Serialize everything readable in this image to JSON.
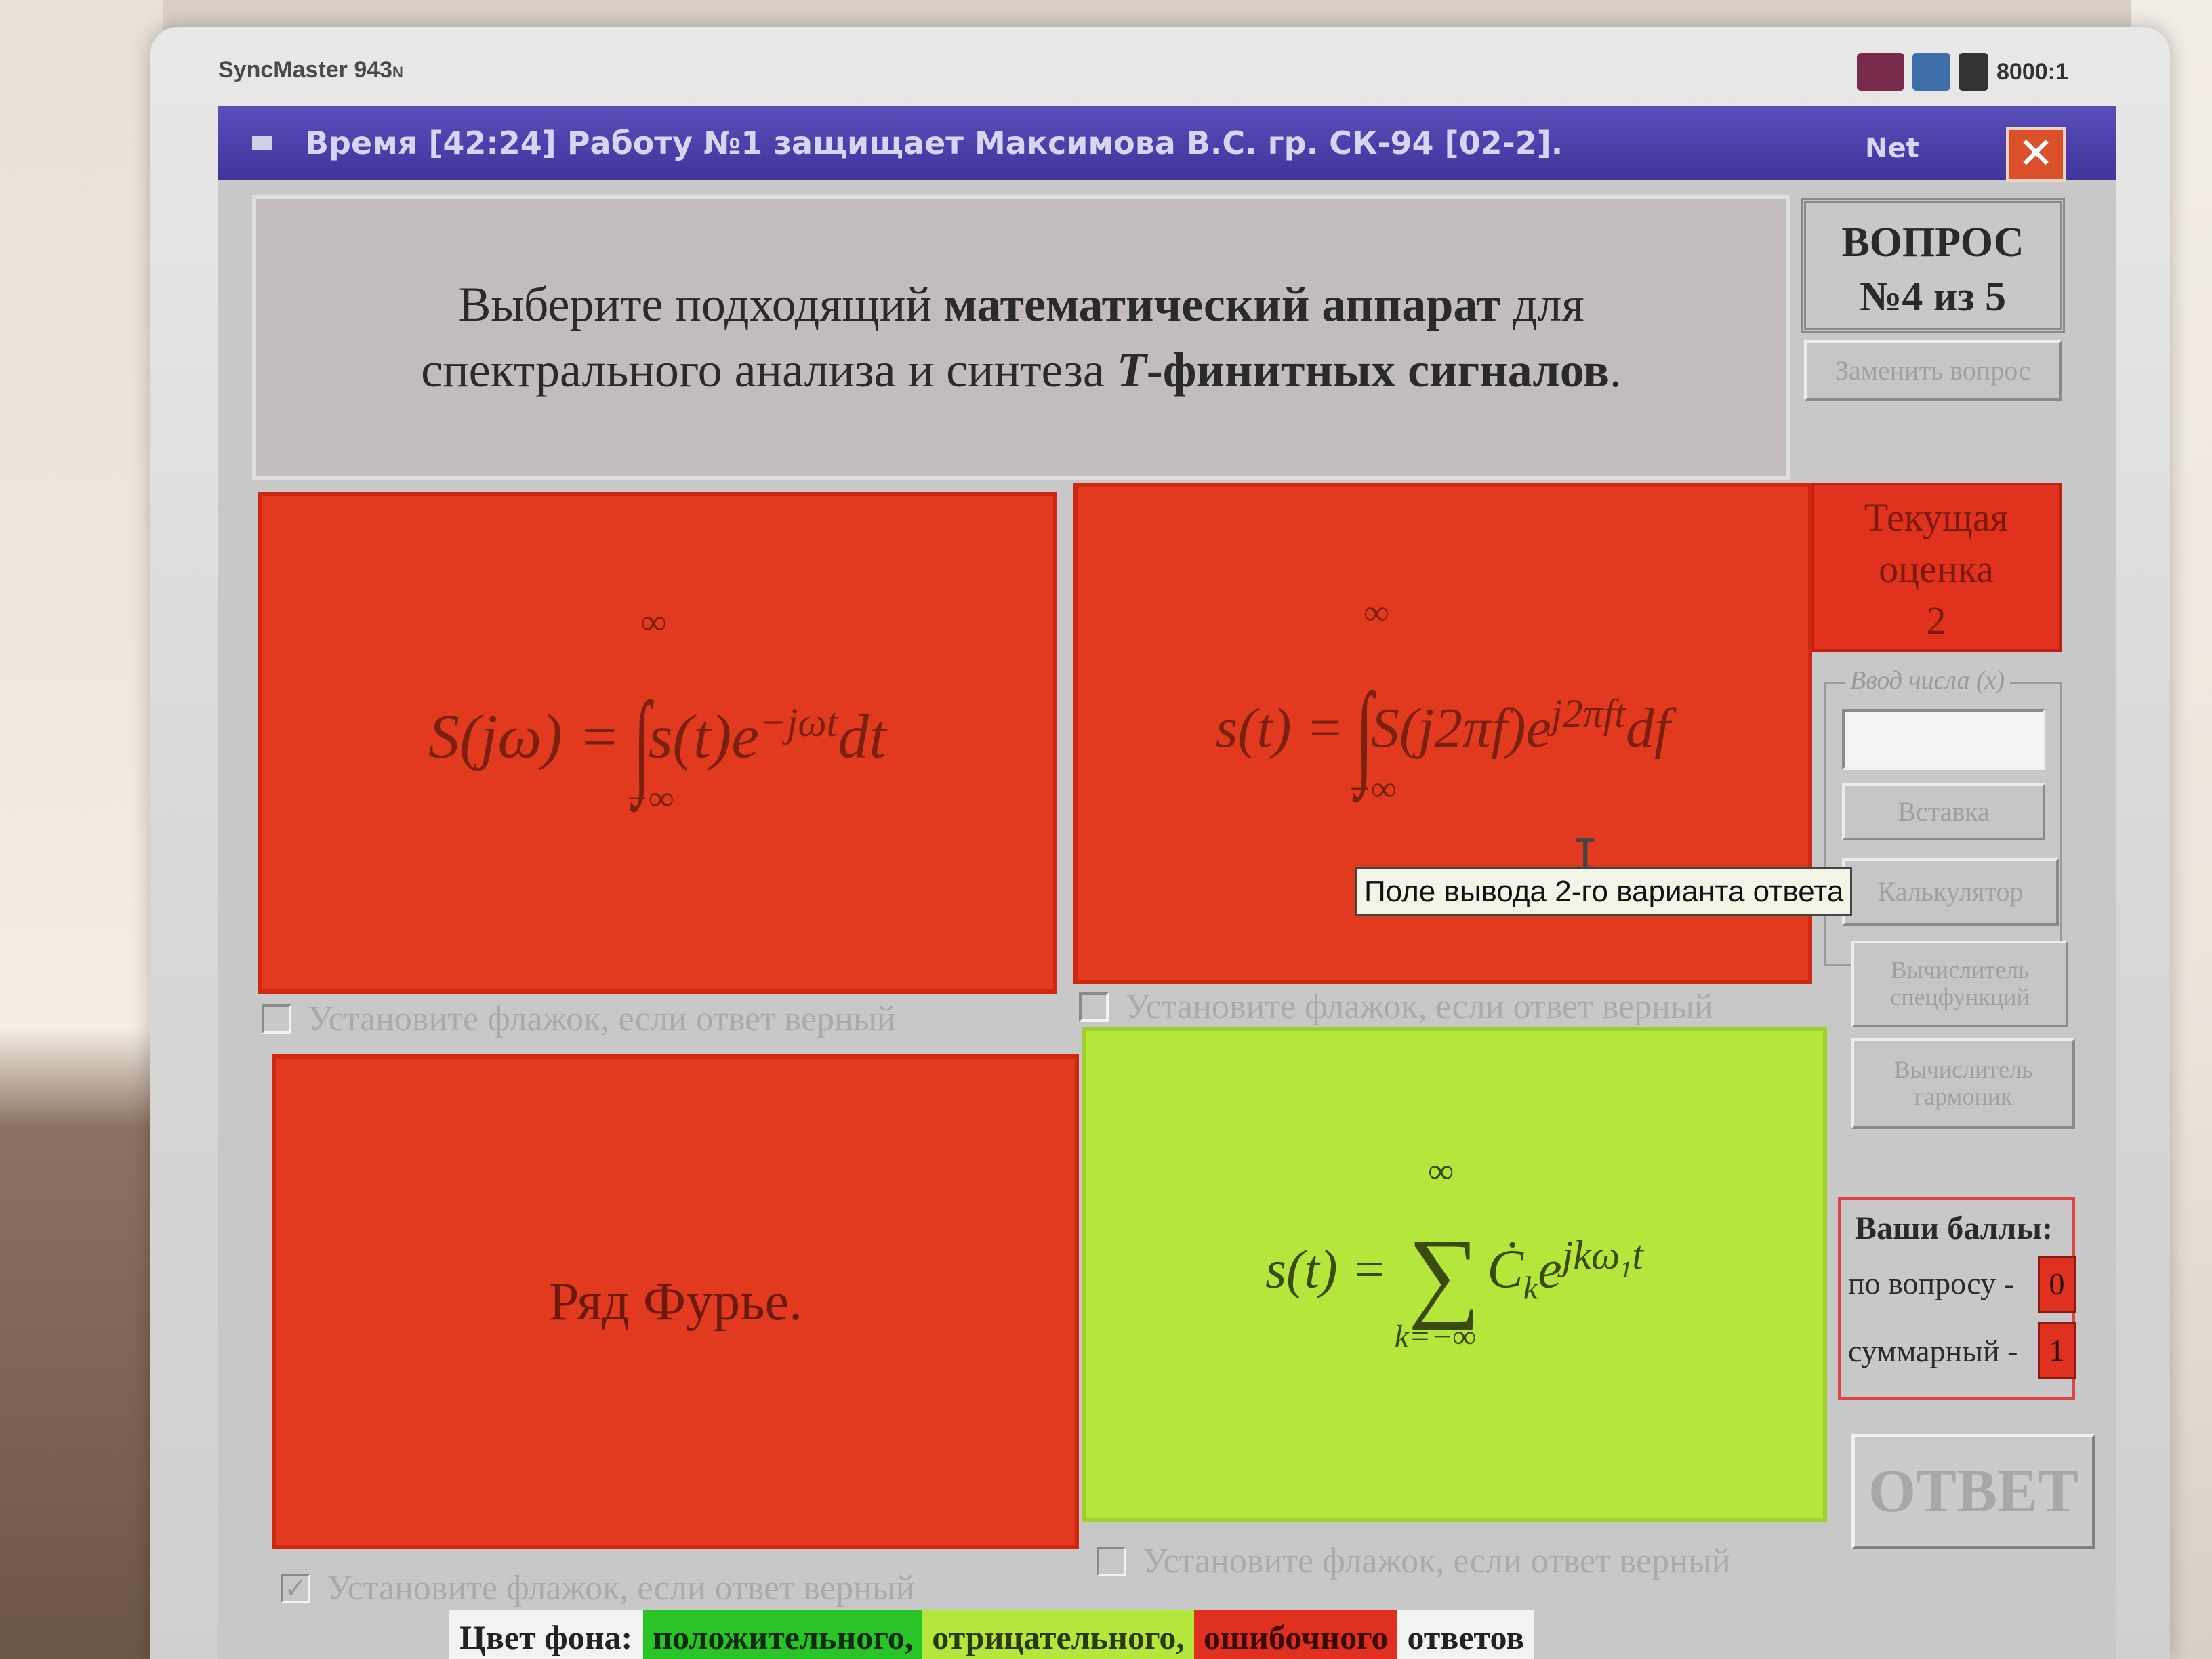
{
  "monitor": {
    "brand": "SyncMaster 943",
    "brand_suffix": "N",
    "contrast": "8000:1"
  },
  "window": {
    "title": "Время [42:24] Работу №1 защищает Максимова В.С.  гр. СК-94 [02-2].",
    "net_label": "Net",
    "close_glyph": "✕"
  },
  "question": {
    "text_part1": "Выберите подходящий ",
    "text_bold1": "математический аппарат",
    "text_part2": " для спектрального анализа и синтеза ",
    "text_bold_italic": "T",
    "text_bold2": "-финитных сигналов",
    "text_end": "."
  },
  "sidebar": {
    "question_label": "ВОПРОС",
    "question_counter": "№4 из 5",
    "replace_button": "Заменить вопрос",
    "grade_label_line1": "Текущая",
    "grade_label_line2": "оценка",
    "grade_value": "2",
    "number_input_legend": "Ввод числа (x)",
    "number_input_value": "",
    "paste_button": "Вставка",
    "calculator_button": "Калькулятор",
    "special_functions_button": "Вычислитель спецфункций",
    "harmonics_button": "Вычислитель гармоник",
    "scores_title": "Ваши баллы:",
    "score_question_label": "по вопросу -",
    "score_question_value": "0",
    "score_total_label": "суммарный -",
    "score_total_value": "1",
    "answer_button": "ОТВЕТ"
  },
  "answers": [
    {
      "status": "error",
      "lhs": "S(jω) =",
      "integrand": "s(t)e",
      "exponent": "−jωt",
      "tail": "dt",
      "upper": "∞",
      "lower": "−∞",
      "checkbox_label": "Установите флажок, если ответ верный",
      "checked": false
    },
    {
      "status": "error",
      "lhs": "s(t) =",
      "integrand": "S(j2πf)e",
      "exponent": "j2πft",
      "tail": "df",
      "upper": "∞",
      "lower": "−∞",
      "checkbox_label": "Установите флажок, если ответ верный",
      "checked": false
    },
    {
      "status": "error",
      "text": "Ряд Фурье.",
      "checkbox_label": "Установите флажок, если ответ верный",
      "checked": true
    },
    {
      "status": "negative",
      "lhs": "s(t) =",
      "sum_upper": "∞",
      "sum_lower": "k=−∞",
      "term": "Ċ",
      "term_sub": "k",
      "base": "e",
      "exponent": "jkω",
      "exponent_sub": "1",
      "exponent_tail": "t",
      "checkbox_label": "Установите флажок, если ответ верный",
      "checked": false
    }
  ],
  "tooltip": "Поле вывода 2-го варианта ответа",
  "legend": {
    "label": "Цвет фона:",
    "positive": "положительного,",
    "negative": "отрицательного,",
    "error": "ошибочного",
    "answers": "ответов"
  },
  "colors": {
    "error": "#e23a1e",
    "negative": "#b4e63c",
    "positive": "#28c428",
    "titlebar": "#4a3fa8"
  }
}
